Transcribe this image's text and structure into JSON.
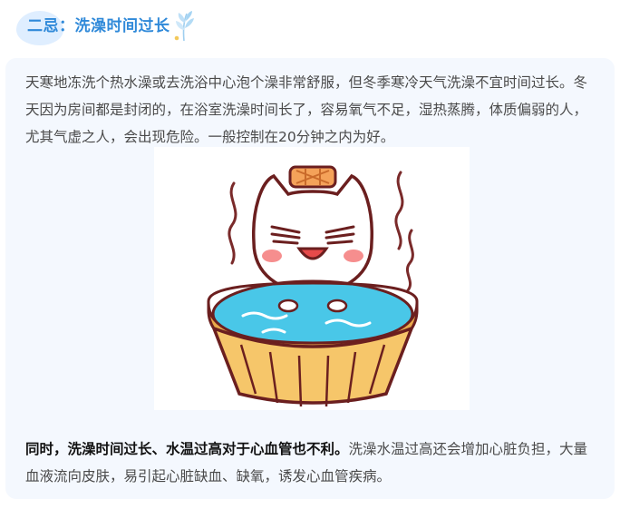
{
  "header": {
    "title": "二忌：洗澡时间过长",
    "decoration_icon": "wheat-leaf-icon",
    "accent_color": "#2f89d9",
    "blob_color": "#dfeeff"
  },
  "content": {
    "paragraph1": "天寒地冻洗个热水澡或去洗浴中心泡个澡非常舒服，但冬季寒冷天气洗澡不宜时间过长。冬天因为房间都是封闭的，在浴室洗澡时间长了，容易氧气不足，湿热蒸腾，体质偏弱的人，尤其气虚之人，会出现危险。一般控制在20分钟之内为好。",
    "illustration": "cat-in-bathtub-illustration",
    "paragraph2_bold": "同时，洗澡时间过长、水温过高对于心血管也不利。",
    "paragraph2_rest": "洗澡水温过高还会增加心脏负担，大量血液流向皮肤，易引起心脏缺血、缺氧，诱发心血管疾病。",
    "card_background": "#f4f8fe"
  }
}
